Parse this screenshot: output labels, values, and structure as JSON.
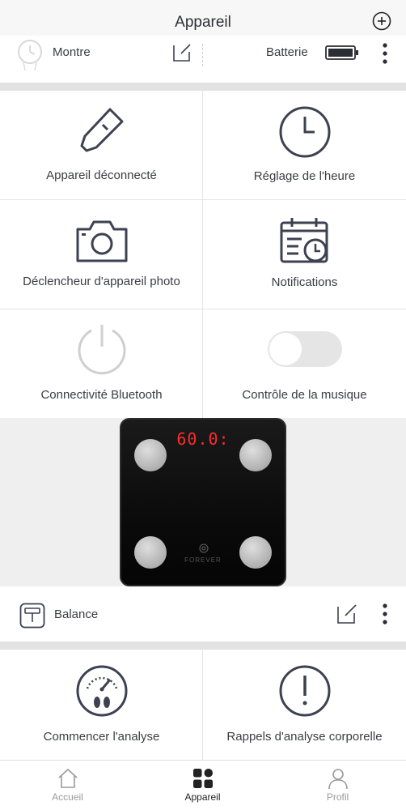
{
  "header": {
    "title": "Appareil"
  },
  "device": {
    "name": "Montre",
    "battery_label": "Batterie"
  },
  "features": [
    {
      "label": "Appareil déconnecté",
      "icon": "disconnected-icon"
    },
    {
      "label": "Réglage de l'heure",
      "icon": "clock-icon"
    },
    {
      "label": "Déclencheur d'appareil photo",
      "icon": "camera-icon"
    },
    {
      "label": "Notifications",
      "icon": "calendar-clock-icon"
    },
    {
      "label": "Connectivité Bluetooth",
      "icon": "power-icon"
    },
    {
      "label": "Contrôle de la musique",
      "icon": "toggle-icon"
    }
  ],
  "scale_image": {
    "reading": "60.0:",
    "brand": "FOREVER"
  },
  "scale": {
    "name": "Balance"
  },
  "scale_features": [
    {
      "label": "Commencer l'analyse",
      "icon": "gauge-footprints-icon"
    },
    {
      "label": "Rappels d'analyse corporelle",
      "icon": "alert-icon"
    }
  ],
  "tabs": [
    {
      "label": "Accueil",
      "icon": "home-icon",
      "active": false
    },
    {
      "label": "Appareil",
      "icon": "apps-grid-icon",
      "active": true
    },
    {
      "label": "Profil",
      "icon": "user-icon",
      "active": false
    }
  ],
  "colors": {
    "active_tab": "#222222",
    "inactive_tab": "#9a9a9a",
    "icon_stroke": "#3d4150",
    "battery_fill": "#2a2c36"
  }
}
